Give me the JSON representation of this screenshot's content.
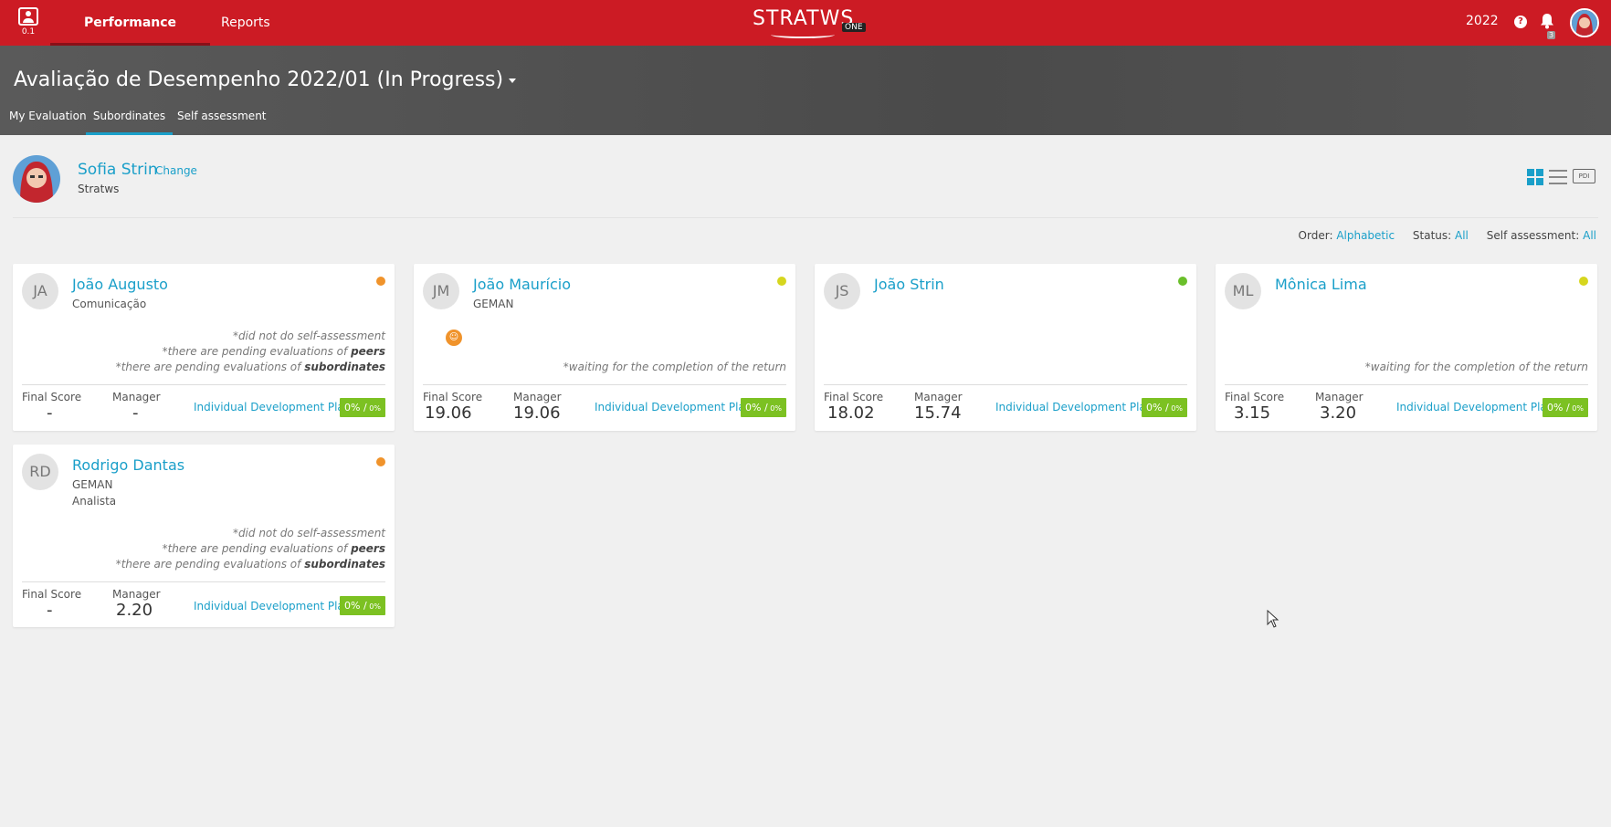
{
  "app": {
    "version": "0.1",
    "nav": {
      "performance": "Performance Evaluation",
      "reports": "Reports"
    },
    "logo": {
      "text": "STRATWS",
      "badge": "ONE"
    },
    "year": "2022",
    "help_icon": "?",
    "notifications": "3"
  },
  "header": {
    "title": "Avaliação de Desempenho 2022/01 (In Progress)",
    "tabs": {
      "my": "My Evaluation",
      "sub": "Subordinates",
      "self": "Self assessment"
    }
  },
  "user": {
    "name": "Sofia Strin",
    "change": "Change",
    "company": "Stratws"
  },
  "view": {
    "pdi": "PDI"
  },
  "filters": {
    "order_label": "Order:",
    "order_value": "Alphabetic",
    "status_label": "Status:",
    "status_value": "All",
    "self_label": "Self assessment:",
    "self_value": "All"
  },
  "labels": {
    "final_score": "Final Score",
    "manager": "Manager",
    "idp": "Individual Development Plan"
  },
  "colors": {
    "orange": "#f0932b",
    "yellow": "#d6d61e",
    "green": "#6abf2a",
    "accent": "#1a9fc9",
    "brand": "#cc1b24"
  },
  "cards": [
    {
      "initials": "JA",
      "name": "João Augusto",
      "dept": "Comunicação",
      "role": "",
      "warn1": "*did not do self-assessment",
      "warn2_pre": "*there are pending evaluations of ",
      "warn2_bold": "peers",
      "warn3_pre": "*there are pending evaluations of ",
      "warn3_bold": "subordinates",
      "final": "-",
      "manager": "-",
      "pct_main": "0% /",
      "pct_small": " 0%",
      "status": "orange"
    },
    {
      "initials": "JM",
      "name": "João Maurício",
      "dept": "GEMAN",
      "role": "",
      "waiting": "*waiting for the completion of the return",
      "final": "19.06",
      "manager": "19.06",
      "pct_main": "0% /",
      "pct_small": " 0%",
      "status": "yellow"
    },
    {
      "initials": "JS",
      "name": "João Strin",
      "dept": "",
      "role": "",
      "final": "18.02",
      "manager": "15.74",
      "pct_main": "0% /",
      "pct_small": " 0%",
      "status": "green"
    },
    {
      "initials": "ML",
      "name": "Mônica Lima",
      "dept": "",
      "role": "",
      "waiting": "*waiting for the completion of the return",
      "final": "3.15",
      "manager": "3.20",
      "pct_main": "0% /",
      "pct_small": " 0%",
      "status": "yellow"
    },
    {
      "initials": "RD",
      "name": "Rodrigo Dantas",
      "dept": "GEMAN",
      "role": "Analista",
      "warn1": "*did not do self-assessment",
      "warn2_pre": "*there are pending evaluations of ",
      "warn2_bold": "peers",
      "warn3_pre": "*there are pending evaluations of ",
      "warn3_bold": "subordinates",
      "final": "-",
      "manager": "2.20",
      "pct_main": "0% /",
      "pct_small": " 0%",
      "status": "orange"
    }
  ]
}
